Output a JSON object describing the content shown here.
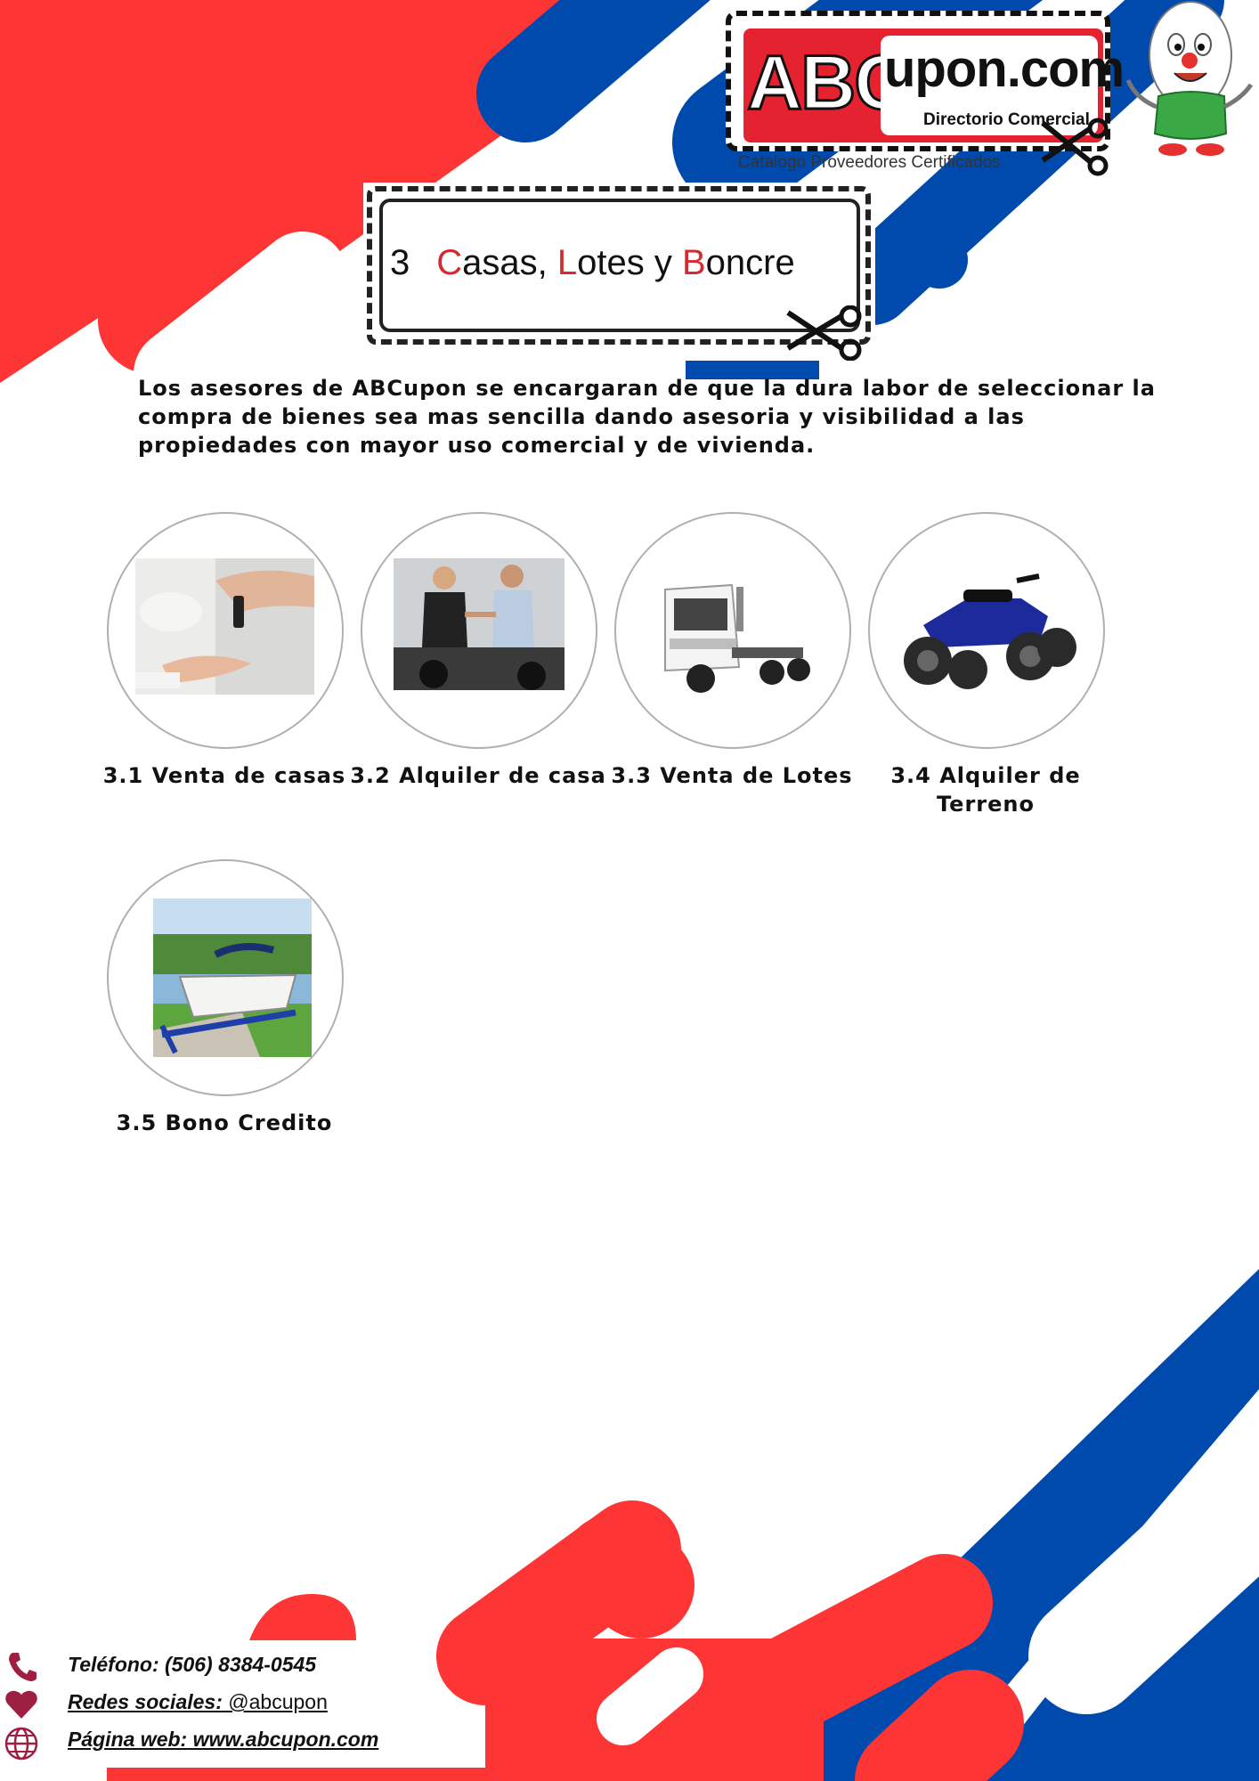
{
  "colors": {
    "red": "#fd3535",
    "blue": "#004aad",
    "accent_red": "#d62a32",
    "icon_maroon": "#9e2040"
  },
  "brand": {
    "logo_abc": "ABC",
    "logo_domain": "upon.com",
    "logo_subtitle": "Directorio Comercial",
    "tagline": "Catalogo Proveedores Certificados"
  },
  "section": {
    "number": "3",
    "title_parts": [
      {
        "text": "C",
        "red": true
      },
      {
        "text": "asas, ",
        "red": false
      },
      {
        "text": "L",
        "red": true
      },
      {
        "text": "otes y ",
        "red": false
      },
      {
        "text": "B",
        "red": true
      },
      {
        "text": "oncre",
        "red": false
      }
    ]
  },
  "intro": "Los asesores de ABCupon se encargaran de que la dura labor de seleccionar la compra de bienes sea mas sencilla dando asesoria y visibilidad a las propiedades con mayor uso comercial y de vivienda.",
  "items": [
    {
      "caption": "3.1 Venta de casas",
      "image": "car-key-handover-photo"
    },
    {
      "caption": "3.2 Alquiler de casa",
      "image": "motorcycle-dealership-photo"
    },
    {
      "caption": "3.3 Venta de Lotes",
      "image": "white-truck-photo"
    },
    {
      "caption": "3.4 Alquiler de Terreno",
      "image": "blue-atv-photo"
    },
    {
      "caption": "3.5 Bono Credito",
      "image": "boat-on-trailer-photo"
    }
  ],
  "footer": {
    "phone": "Teléfono: (506) 8384-0545",
    "social_label": "Redes sociales:",
    "social_handle": " @abcupon",
    "web": "Página web: www.abcupon.com",
    "icons": [
      "phone-icon",
      "heart-icon",
      "globe-icon"
    ]
  }
}
